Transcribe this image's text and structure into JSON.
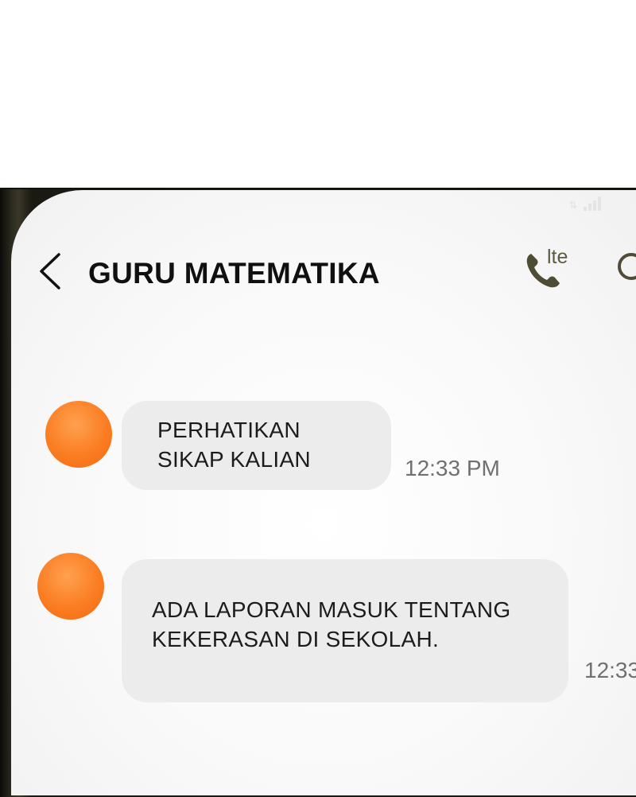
{
  "header": {
    "title": "GURU MATEMATIKA",
    "call_badge": "lte"
  },
  "messages": [
    {
      "lines": [
        "PERHATIKAN",
        "SIKAP KALIAN"
      ],
      "time": "12:33 PM"
    },
    {
      "lines": [
        "ADA LAPORAN MASUK TENTANG",
        "KEKERASAN DI SEKOLAH."
      ],
      "time": "12:33"
    }
  ],
  "colors": {
    "avatar": "#fb7d22",
    "bubble": "#ececec",
    "icon": "#4f4c36"
  },
  "icons": [
    "back-icon",
    "phone-call-icon",
    "search-icon",
    "signal-icon",
    "avatar"
  ]
}
